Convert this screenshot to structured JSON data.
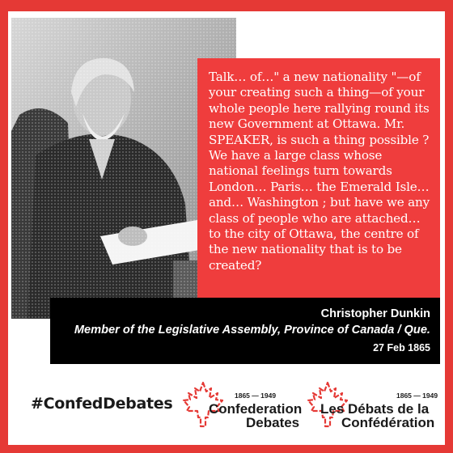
{
  "quote": {
    "text": "Talk… of…\" a new nationality \"—of your creating such a thing—of your whole people here rallying round its new Government at Ottawa. Mr. SPEAKER, is such a thing possible ? We have a large class whose national feelings turn towards London… Paris… the Emerald Isle… and… Washington ; but have we any class of people who are attached… to the city of Ottawa, the centre of the new nationality that is to be created?"
  },
  "attribution": {
    "name": "Christopher Dunkin",
    "role": "Member of the Legislative Assembly, Province of Canada / Que.",
    "date": "27 Feb 1865"
  },
  "footer": {
    "hashtag": "#ConfedDebates",
    "logo_en": {
      "years": "1865 — 1949",
      "line1": "Confederation",
      "line2": "Debates"
    },
    "logo_fr": {
      "years": "1865 — 1949",
      "line1": "Les Débats de la",
      "line2": "Confédération"
    }
  },
  "colors": {
    "accent": "#ef3d3d",
    "frame": "#e53935",
    "attribution_bg": "#000000"
  },
  "icons": {
    "logo_mark": "maple-leaf-outline-icon"
  }
}
